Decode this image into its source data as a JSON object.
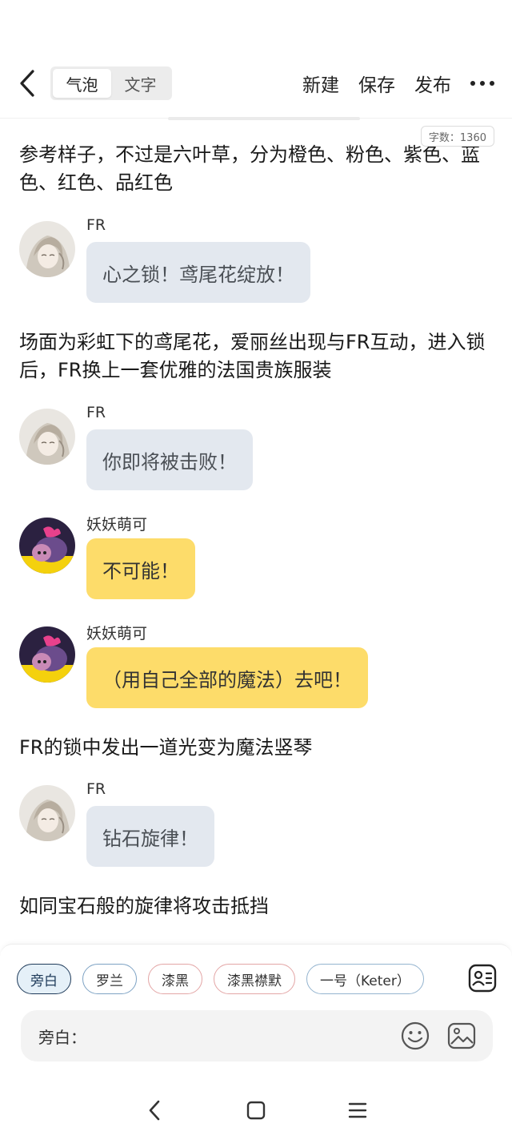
{
  "header": {
    "mode_tabs": [
      "气泡",
      "文字"
    ],
    "active_tab": 0,
    "new_label": "新建",
    "save_label": "保存",
    "publish_label": "发布",
    "word_count": "字数：1360"
  },
  "content": {
    "narration_1": "参考样子，不过是六叶草，分为橙色、粉色、紫色、蓝色、红色、品红色",
    "msg_1": {
      "sender": "FR",
      "text": "心之锁！鸢尾花绽放！"
    },
    "narration_2": "场面为彩虹下的鸢尾花，爱丽丝出现与FR互动，进入锁后，FR换上一套优雅的法国贵族服装",
    "msg_2": {
      "sender": "FR",
      "text": "你即将被击败！"
    },
    "msg_3": {
      "sender": "妖妖萌可",
      "text": "不可能！"
    },
    "msg_4": {
      "sender": "妖妖萌可",
      "text": "（用自己全部的魔法）去吧！"
    },
    "narration_3": "FR的锁中发出一道光变为魔法竖琴",
    "msg_5": {
      "sender": "FR",
      "text": "钻石旋律！"
    },
    "narration_4": "如同宝石般的旋律将攻击抵挡"
  },
  "composer": {
    "roles": [
      "旁白",
      "罗兰",
      "漆黑",
      "漆黑襟默",
      "一号（Keter）"
    ],
    "selected_role": 0,
    "input_label": "旁白：",
    "input_value": ""
  },
  "colors": {
    "bubble_fr": "#e3e8ef",
    "bubble_yaoyao": "#fddc6a",
    "selected_chip": "#1f3b5a"
  }
}
